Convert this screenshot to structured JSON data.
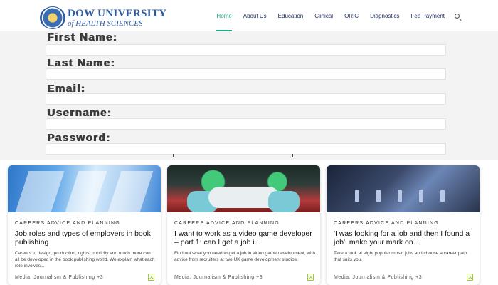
{
  "header": {
    "logo_line1": "DOW UNIVERSITY",
    "logo_line2": "of HEALTH SCIENCES",
    "nav": [
      "Home",
      "About Us",
      "Education",
      "Clinical",
      "ORIC",
      "Diagnostics",
      "Fee Payment"
    ],
    "active_nav": "Home",
    "accent_color": "#1ba885"
  },
  "form": {
    "fields": [
      "First Name:",
      "Last Name:",
      "Email:",
      "Username:",
      "Password:"
    ]
  },
  "cards": [
    {
      "kicker": "CAREERS ADVICE AND PLANNING",
      "title": "Job roles and types of employers in book publishing",
      "text": "Careers in design, production, rights, publicity and much more can all be developed in the book publishing world. We explain what each role involves...",
      "tags": "Media, Journalism & Publishing +3",
      "image": "book-pages-image"
    },
    {
      "kicker": "CAREERS ADVICE AND PLANNING",
      "title": "I want to work as a video game developer – part 1: can I get a job i...",
      "text": "Find out what you need to get a job in video game development, with advice from recruiters at two UK game development studios.",
      "tags": "Media, Journalism & Publishing +3",
      "image": "game-controller-image"
    },
    {
      "kicker": "CAREERS ADVICE AND PLANNING",
      "title": "'I was looking for a job and then I found a job': make your mark on...",
      "text": "Take a look at eight popular music jobs and choose a career path that suits you.",
      "tags": "Media, Journalism & Publishing +3",
      "image": "mixing-desk-image"
    }
  ]
}
